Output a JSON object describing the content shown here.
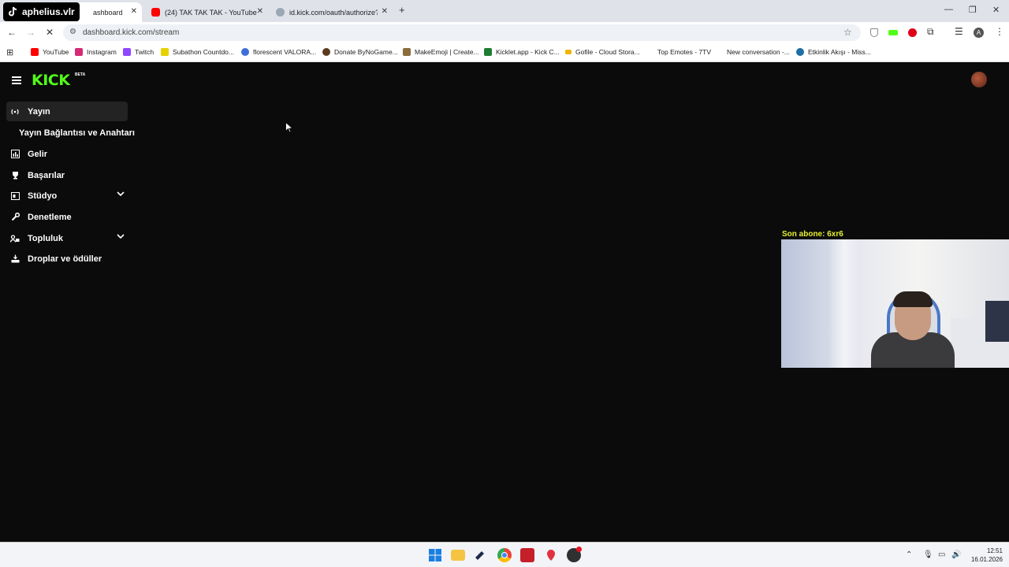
{
  "browser": {
    "watermark": "aphelius.vlr",
    "tabs": [
      {
        "title": "ashboard",
        "active": true
      },
      {
        "title": "(24) TAK TAK TAK - YouTube",
        "active": false
      },
      {
        "title": "id.kick.com/oauth/authorize?re",
        "active": false
      }
    ],
    "new_tab": "+",
    "url": "dashboard.kick.com/stream",
    "bookmarks": [
      {
        "label": "YouTube",
        "color": "#ff0000"
      },
      {
        "label": "Instagram",
        "color": "#d62976"
      },
      {
        "label": "Twitch",
        "color": "#9146ff"
      },
      {
        "label": "Subathon Countdo...",
        "color": "#e6d200"
      },
      {
        "label": "florescent VALORA...",
        "color": "#3f6fd8"
      },
      {
        "label": "Donate ByNoGame...",
        "color": "#5b3a1e"
      },
      {
        "label": "MakeEmoji | Create...",
        "color": "#8a6d3b"
      },
      {
        "label": "Kicklet.app - Kick C...",
        "color": "#1e7d32"
      },
      {
        "label": "Gofile - Cloud Stora...",
        "color": "#f0b400"
      },
      {
        "label": "Top Emotes - 7TV",
        "color": "#ffffff"
      },
      {
        "label": "New conversation -...",
        "color": "#ffffff"
      },
      {
        "label": "Etkinlik Akışı - Miss...",
        "color": "#1d6fa5"
      }
    ]
  },
  "app": {
    "logo": "KICK",
    "beta": "BETA",
    "accent": "#53fc18",
    "sidebar": [
      {
        "label": "Yayın",
        "icon": "broadcast-icon",
        "active": true
      },
      {
        "label": "Yayın Bağlantısı ve Anahtarı",
        "sub": true
      },
      {
        "label": "Gelir",
        "icon": "chart-icon"
      },
      {
        "label": "Başarılar",
        "icon": "trophy-icon"
      },
      {
        "label": "Stüdyo",
        "icon": "studio-icon",
        "expandable": true
      },
      {
        "label": "Denetleme",
        "icon": "wrench-icon"
      },
      {
        "label": "Topluluk",
        "icon": "community-icon",
        "expandable": true
      },
      {
        "label": "Droplar ve ödüller",
        "icon": "drops-icon"
      }
    ]
  },
  "overlay": {
    "last_sub_label": "Son abone: 6xr6",
    "label_color": "#e8f030"
  },
  "taskbar": {
    "time": "12:51",
    "date": "16.01.2026"
  }
}
